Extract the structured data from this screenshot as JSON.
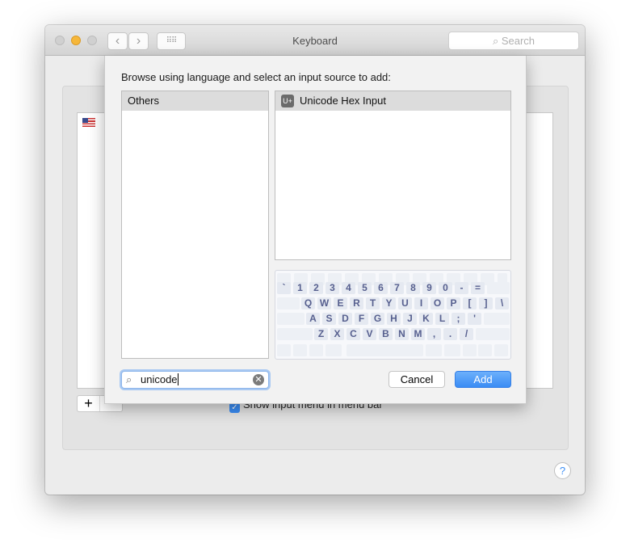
{
  "window": {
    "title": "Keyboard",
    "search_placeholder": "Search"
  },
  "background": {
    "checkbox_label": "Show input menu in menu bar",
    "add_label": "+",
    "help_label": "?"
  },
  "sheet": {
    "prompt": "Browse using language and select an input source to add:",
    "languages": [
      "Others"
    ],
    "sources": [
      {
        "badge": "U+",
        "label": "Unicode Hex Input"
      }
    ],
    "search_value": "unicode",
    "cancel_label": "Cancel",
    "add_label": "Add"
  },
  "keyboard": {
    "rows": [
      [
        "`",
        "1",
        "2",
        "3",
        "4",
        "5",
        "6",
        "7",
        "8",
        "9",
        "0",
        "-",
        "="
      ],
      [
        "Q",
        "W",
        "E",
        "R",
        "T",
        "Y",
        "U",
        "I",
        "O",
        "P",
        "[",
        "]",
        "\\"
      ],
      [
        "A",
        "S",
        "D",
        "F",
        "G",
        "H",
        "J",
        "K",
        "L",
        ";",
        "'"
      ],
      [
        "Z",
        "X",
        "C",
        "V",
        "B",
        "N",
        "M",
        ",",
        ".",
        "/"
      ]
    ]
  },
  "colors": {
    "accent": "#3b8ef5",
    "key_text": "#57608f"
  }
}
